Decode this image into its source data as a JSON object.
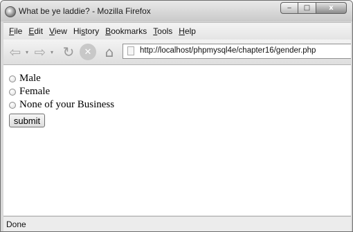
{
  "window": {
    "title": "What be ye laddie? - Mozilla Firefox",
    "minimize": "‒",
    "maximize": "□",
    "close": "x"
  },
  "menu": [
    {
      "key": "F",
      "rest": "ile"
    },
    {
      "key": "E",
      "rest": "dit"
    },
    {
      "key": "V",
      "rest": "iew"
    },
    {
      "key": "",
      "pre": "Hi",
      "keymid": "s",
      "rest": "tory"
    },
    {
      "key": "B",
      "rest": "ookmarks"
    },
    {
      "key": "T",
      "rest": "ools"
    },
    {
      "key": "H",
      "rest": "elp"
    }
  ],
  "nav": {
    "back_icon": "back-arrow-icon",
    "forward_icon": "forward-arrow-icon",
    "reload_icon": "reload-icon",
    "stop_icon": "stop-icon",
    "home_icon": "home-icon",
    "url": "http://localhost/phpmysql4e/chapter16/gender.php"
  },
  "form": {
    "options": [
      "Male",
      "Female",
      "None of your Business"
    ],
    "submit_label": "submit"
  },
  "status": {
    "text": "Done"
  }
}
